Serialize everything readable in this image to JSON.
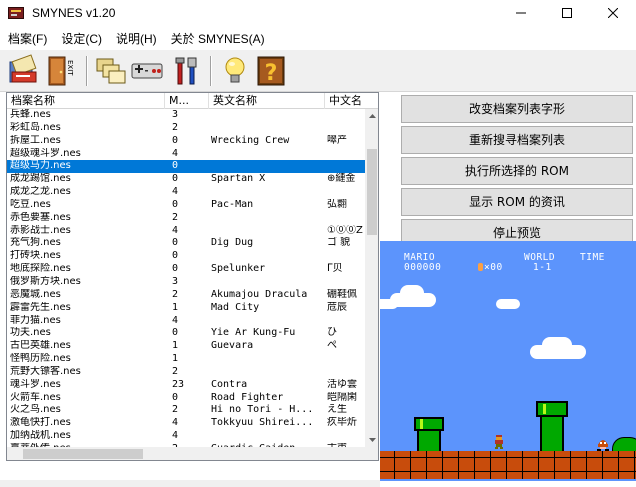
{
  "window": {
    "title": "SMYNES v1.20",
    "controls": {
      "minimize": "—",
      "maximize": "☐",
      "close": "✕"
    }
  },
  "menu": [
    {
      "label": "档案(F)"
    },
    {
      "label": "设定(C)"
    },
    {
      "label": "说明(H)"
    },
    {
      "label": "关於 SMYNES(A)"
    }
  ],
  "toolbar": {
    "items": [
      {
        "icon": "open-file-icon"
      },
      {
        "icon": "exit-door-icon",
        "label": "EXIT"
      },
      {
        "icon": "folders-icon"
      },
      {
        "icon": "nes-controller-icon"
      },
      {
        "icon": "tools-icon"
      },
      {
        "icon": "lightbulb-icon"
      },
      {
        "icon": "help-question-icon",
        "label": "?"
      }
    ]
  },
  "list": {
    "columns": [
      "档案名称",
      "M...",
      "英文名称",
      "中文名"
    ],
    "rows": [
      {
        "name": "兵蜂.nes",
        "size": "3",
        "en": "",
        "cn": ""
      },
      {
        "name": "彩虹岛.nes",
        "size": "2",
        "en": "",
        "cn": ""
      },
      {
        "name": "拆屋工.nes",
        "size": "0",
        "en": "Wrecking Crew",
        "cn": "噿产"
      },
      {
        "name": "超级魂斗罗.nes",
        "size": "4",
        "en": "",
        "cn": ""
      },
      {
        "name": "超级马力.nes",
        "size": "0",
        "en": "",
        "cn": "",
        "selected": true
      },
      {
        "name": "成龙踢馆.nes",
        "size": "0",
        "en": "Spartan X",
        "cn": "⊕縺金"
      },
      {
        "name": "成龙之龙.nes",
        "size": "4",
        "en": "",
        "cn": ""
      },
      {
        "name": "吃豆.nes",
        "size": "0",
        "en": "Pac-Man",
        "cn": "弘翾"
      },
      {
        "name": "赤色要塞.nes",
        "size": "2",
        "en": "",
        "cn": ""
      },
      {
        "name": "赤影战士.nes",
        "size": "4",
        "en": "",
        "cn": "①⓪⓪Z"
      },
      {
        "name": "充气狗.nes",
        "size": "0",
        "en": "Dig Dug",
        "cn": "ゴ 貌"
      },
      {
        "name": "打砖块.nes",
        "size": "0",
        "en": "",
        "cn": ""
      },
      {
        "name": "地底探险.nes",
        "size": "0",
        "en": "Spelunker",
        "cn": "ᒥ贝"
      },
      {
        "name": "俄罗斯方块.nes",
        "size": "3",
        "en": "",
        "cn": ""
      },
      {
        "name": "恶魔城.nes",
        "size": "2",
        "en": "Akumajou Dracula",
        "cn": "硼鞋佩"
      },
      {
        "name": "霹雷先生.nes",
        "size": "1",
        "en": "Mad City",
        "cn": "苊辰"
      },
      {
        "name": "菲力猫.nes",
        "size": "4",
        "en": "",
        "cn": ""
      },
      {
        "name": "功夫.nes",
        "size": "0",
        "en": "Yie Ar Kung-Fu",
        "cn": "ひ"
      },
      {
        "name": "古巴英雄.nes",
        "size": "1",
        "en": "Guevara",
        "cn": "ぺ"
      },
      {
        "name": "怪鸭历险.nes",
        "size": "1",
        "en": "",
        "cn": ""
      },
      {
        "name": "荒野大镖客.nes",
        "size": "2",
        "en": "",
        "cn": ""
      },
      {
        "name": "魂斗罗.nes",
        "size": "23",
        "en": "Contra",
        "cn": "活ゆ雲"
      },
      {
        "name": "火箭车.nes",
        "size": "0",
        "en": "Road Fighter",
        "cn": "皑隔閑"
      },
      {
        "name": "火之鸟.nes",
        "size": "2",
        "en": "Hi no Tori - H...",
        "cn": "え生"
      },
      {
        "name": "激龟快打.nes",
        "size": "4",
        "en": "Tokkyuu Shirei...",
        "cn": "疚毕炘"
      },
      {
        "name": "加纳战机.nes",
        "size": "4",
        "en": "",
        "cn": ""
      },
      {
        "name": "嘉蒂外传.nes",
        "size": "2",
        "en": "Guardic Gaiden",
        "cn": "古甫"
      }
    ]
  },
  "actions": [
    {
      "label": "改变档案列表字形"
    },
    {
      "label": "重新搜寻档案列表"
    },
    {
      "label": "执行所选择的 ROM"
    },
    {
      "label": "显示 ROM 的资讯"
    },
    {
      "label": "停止预览"
    }
  ],
  "preview": {
    "hud": {
      "player": "MARIO",
      "score": "000000",
      "coins": "×00",
      "world_label": "WORLD",
      "world": "1-1",
      "time_label": "TIME"
    },
    "colors": {
      "sky": "#5c94fc",
      "ground": "#c84c0c",
      "pipe": "#00a800"
    }
  }
}
